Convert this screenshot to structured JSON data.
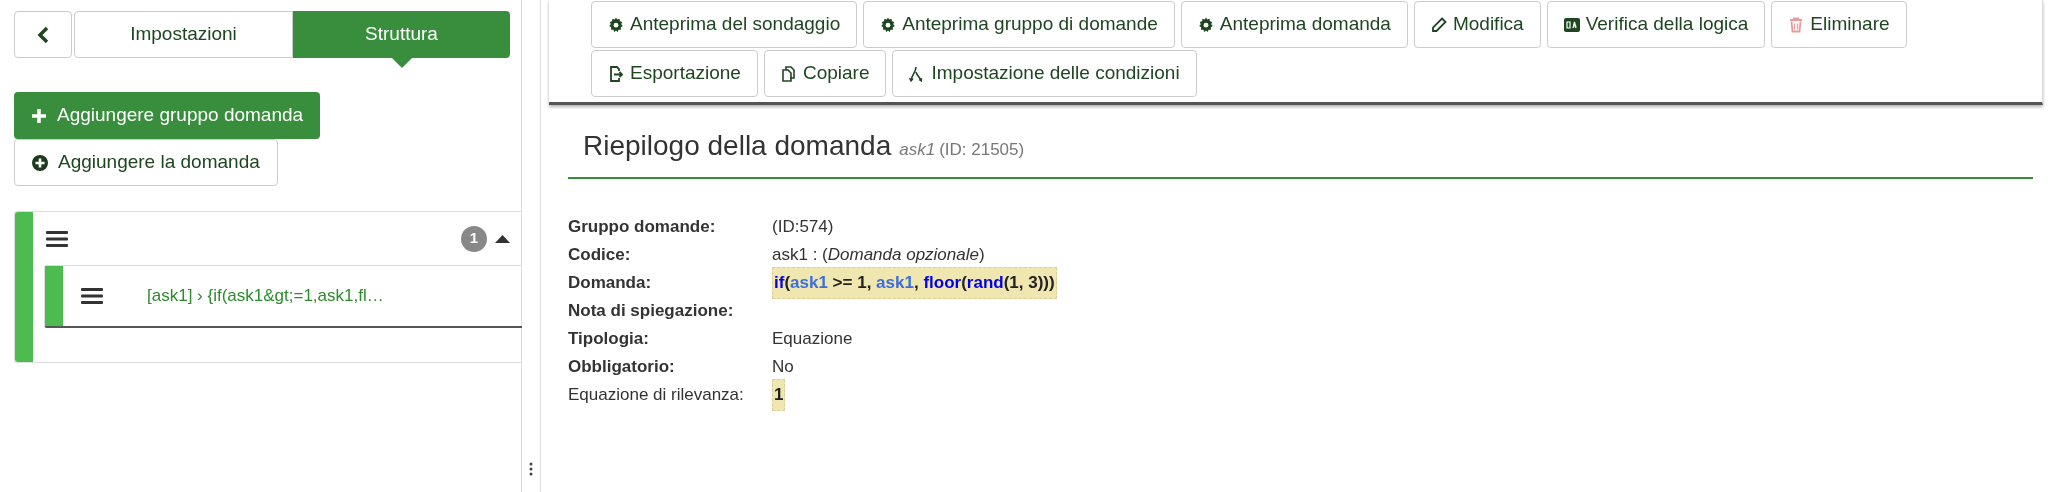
{
  "sidebar": {
    "tabs": [
      {
        "label": "Impostazioni",
        "selected": false
      },
      {
        "label": "Struttura",
        "selected": true
      }
    ],
    "actions": [
      {
        "label": "Aggiungere gruppo domanda",
        "kind": "primary"
      },
      {
        "label": "Aggiungere la domanda",
        "kind": "secondary"
      }
    ],
    "group": {
      "count": "1",
      "expanded": true,
      "questions": [
        {
          "label": "[ask1] › {if(ask1&gt;=1,ask1,fl…"
        }
      ]
    }
  },
  "toolbar": {
    "buttons": [
      {
        "label": "Anteprima del sondaggio",
        "kind": "gear"
      },
      {
        "label": "Anteprima gruppo di domande",
        "kind": "gear"
      },
      {
        "label": "Anteprima domanda",
        "kind": "gear"
      },
      {
        "label": "Modifica",
        "kind": "pencil"
      },
      {
        "label": "Verifica della logica",
        "kind": "qa"
      },
      {
        "label": "Eliminare",
        "kind": "trash"
      },
      {
        "label": "Esportazione",
        "kind": "export"
      },
      {
        "label": "Copiare",
        "kind": "copy"
      },
      {
        "label": "Impostazione delle condizioni",
        "kind": "branch"
      }
    ]
  },
  "summary": {
    "title": "Riepilogo della domanda",
    "code": "ask1",
    "id": "(ID: 21505)",
    "rows": [
      {
        "label": "Gruppo domande:",
        "bold": true,
        "value": "(ID:574)"
      },
      {
        "label": "Codice:",
        "bold": true,
        "value": "ask1 : (*Domanda opzionale*)"
      },
      {
        "label": "Domanda:",
        "bold": true,
        "highlighted": true,
        "tokens": [
          {
            "text": "if",
            "kind": "function"
          },
          {
            "text": "(",
            "kind": "plain"
          },
          {
            "text": "ask1",
            "kind": "variable"
          },
          {
            "text": " >= 1, ",
            "kind": "plain"
          },
          {
            "text": "ask1",
            "kind": "variable"
          },
          {
            "text": ", ",
            "kind": "plain"
          },
          {
            "text": "floor",
            "kind": "function"
          },
          {
            "text": "(",
            "kind": "plain"
          },
          {
            "text": "rand",
            "kind": "function"
          },
          {
            "text": "(1, 3)))",
            "kind": "plain"
          }
        ]
      },
      {
        "label": "Nota di spiegazione:",
        "bold": true
      },
      {
        "label": "Tipologia:",
        "bold": true,
        "value": "Equazione"
      },
      {
        "label": "Obbligatorio:",
        "bold": true,
        "value": "No"
      },
      {
        "label": "Equazione di rilevanza:",
        "bold": false,
        "highlighted": true,
        "value": "1"
      }
    ]
  }
}
